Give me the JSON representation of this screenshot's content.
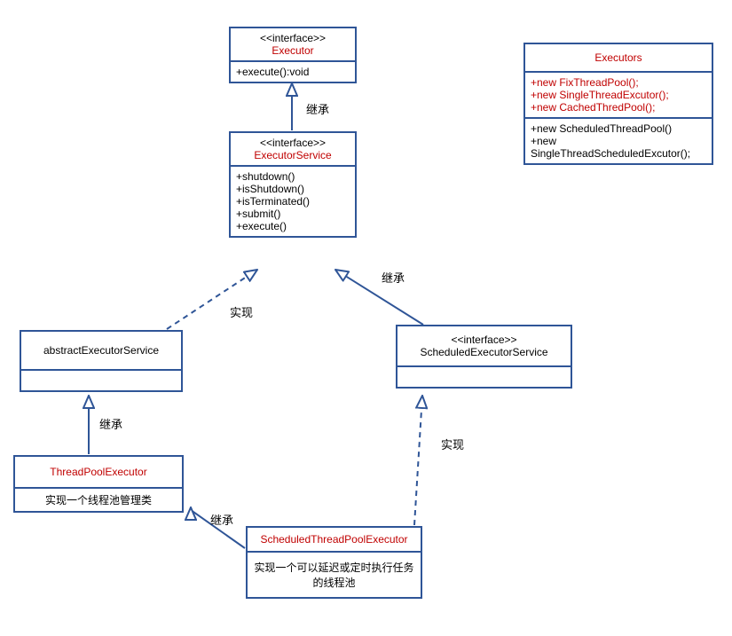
{
  "executor": {
    "stereo": "<<interface>>",
    "name": "Executor",
    "m1": "+execute():void"
  },
  "executorService": {
    "stereo": "<<interface>>",
    "name": "ExecutorService",
    "m1": "+shutdown()",
    "m2": "+isShutdown()",
    "m3": "+isTerminated()",
    "m4": "+submit()",
    "m5": "+execute()"
  },
  "abstractExecutorService": {
    "name": "abstractExecutorService"
  },
  "scheduledExecutorService": {
    "stereo": "<<interface>>",
    "name": "ScheduledExecutorService"
  },
  "threadPoolExecutor": {
    "name": "ThreadPoolExecutor",
    "desc": "实现一个线程池管理类"
  },
  "scheduledThreadPoolExecutor": {
    "name": "ScheduledThreadPoolExecutor",
    "desc": "实现一个可以延迟或定时执行任务的线程池"
  },
  "executors": {
    "name": "Executors",
    "r1": "+new FixThreadPool();",
    "r2": "+new SingleThreadExcutor();",
    "r3": "+new CachedThredPool();",
    "b1": "+new  ScheduledThreadPool()",
    "b2": "+new",
    "b3": "SingleThreadScheduledExcutor();"
  },
  "labels": {
    "inherit1": "继承",
    "inherit2": "继承",
    "inherit3": "继承",
    "inherit4": "继承",
    "realize1": "实现",
    "realize2": "实现"
  }
}
